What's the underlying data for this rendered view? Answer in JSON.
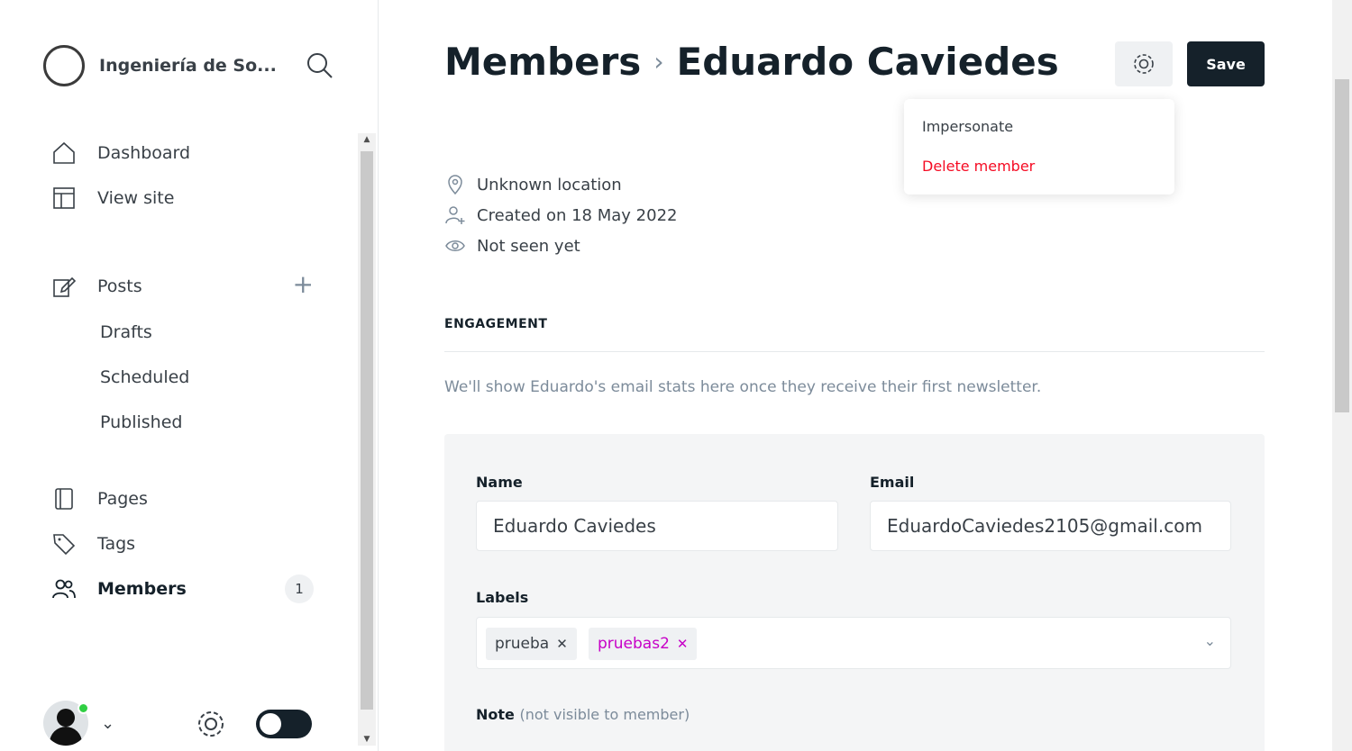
{
  "sidebar": {
    "site_name": "Ingeniería de So...",
    "nav": {
      "dashboard": "Dashboard",
      "view_site": "View site",
      "posts": "Posts",
      "drafts": "Drafts",
      "scheduled": "Scheduled",
      "published": "Published",
      "pages": "Pages",
      "tags": "Tags",
      "members": "Members",
      "members_count": "1",
      "add_post": "+"
    }
  },
  "header": {
    "crumb_parent": "Members",
    "crumb_sep": "›",
    "crumb_current": "Eduardo Caviedes",
    "save_label": "Save"
  },
  "dropdown": {
    "impersonate": "Impersonate",
    "delete": "Delete member"
  },
  "meta": {
    "location": "Unknown location",
    "created": "Created on 18 May 2022",
    "seen": "Not seen yet"
  },
  "engagement": {
    "title": "ENGAGEMENT",
    "text": "We'll show Eduardo's email stats here once they receive their first newsletter."
  },
  "form": {
    "name_label": "Name",
    "name_value": "Eduardo Caviedes",
    "email_label": "Email",
    "email_value": "EduardoCaviedes2105@gmail.com",
    "labels_label": "Labels",
    "tags": [
      "prueba",
      "pruebas2"
    ],
    "note_label": "Note",
    "note_hint": "(not visible to member)"
  },
  "colors": {
    "accent_dark": "#15212a",
    "danger": "#f50b23",
    "online": "#30cf43",
    "tag_pink": "#c700c7"
  }
}
